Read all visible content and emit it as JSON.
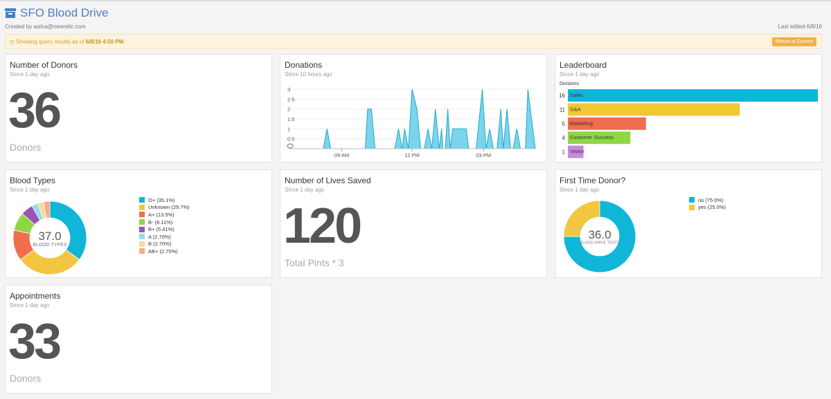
{
  "header": {
    "title": "SFO Blood Drive",
    "created_by": "Created by asilva@newrelic.com",
    "last_edited": "Last edited 6/8/16"
  },
  "banner": {
    "prefix": "Showing query results as of ",
    "timestamp": "6/8/16 4:50 PM",
    "suffix": ".",
    "button": "Return to Current"
  },
  "donors": {
    "title": "Number of Donors",
    "since": "Since 1 day ago",
    "value": "36",
    "unit": "Donors"
  },
  "donations": {
    "title": "Donations",
    "since": "Since 10 hours ago",
    "chart_data": {
      "type": "area",
      "ylim": [
        0,
        3
      ],
      "yticks": [
        "3",
        "2.5",
        "2",
        "1.5",
        "1",
        "0.5",
        "0"
      ],
      "xticks": [
        "09 AM",
        "12 PM",
        "03 PM"
      ],
      "x_fraction": [
        0,
        0.14,
        0.155,
        0.17,
        0.31,
        0.32,
        0.335,
        0.35,
        0.43,
        0.445,
        0.46,
        0.47,
        0.485,
        0.5,
        0.52,
        0.535,
        0.55,
        0.565,
        0.58,
        0.595,
        0.61,
        0.62,
        0.625,
        0.635,
        0.645,
        0.655,
        0.665,
        0.72,
        0.73,
        0.76,
        0.785,
        0.8,
        0.815,
        0.83,
        0.845,
        0.86,
        0.87,
        0.885,
        0.9,
        0.91,
        0.925,
        0.94,
        0.96,
        0.97,
        1
      ],
      "values": [
        0,
        0,
        1,
        0,
        0,
        2,
        2,
        0,
        0,
        1,
        0,
        1,
        0,
        3,
        2,
        0,
        0,
        1,
        0,
        2,
        0,
        1,
        0,
        0,
        2,
        0,
        1,
        1,
        0,
        0,
        3,
        0,
        1,
        0,
        0,
        2,
        0,
        2,
        0,
        0,
        1,
        0,
        0,
        3,
        0
      ],
      "color": "#7ad4eb"
    }
  },
  "leaderboard": {
    "title": "Leaderboard",
    "since": "Since 1 day ago",
    "axis_label": "Divisions",
    "chart_data": {
      "type": "bar",
      "orientation": "horizontal",
      "categories": [
        "Sales",
        "G&A",
        "Marketing",
        "Customer Success",
        "Visitor"
      ],
      "values": [
        16,
        11,
        5,
        4,
        1
      ],
      "colors": [
        "#0fb6d8",
        "#f2c832",
        "#f06d4e",
        "#8fd647",
        "#c68ae0"
      ]
    }
  },
  "blood_types": {
    "title": "Blood Types",
    "since": "Since 1 day ago",
    "center_value": "37.0",
    "center_label": "BLOOD TYPES",
    "chart_data": {
      "type": "pie",
      "categories": [
        "O+",
        "Unknown",
        "A+",
        "B-",
        "B+",
        "A",
        "B",
        "AB+"
      ],
      "values": [
        35.1,
        29.7,
        13.5,
        8.11,
        5.41,
        2.7,
        2.7,
        2.7
      ],
      "legend": [
        "O+ (35.1%)",
        "Unknown (29.7%)",
        "A+ (13.5%)",
        "B- (8.11%)",
        "B+ (5.41%)",
        "A (2.70%)",
        "B (2.70%)",
        "AB+ (2.70%)"
      ],
      "colors": [
        "#0fb6d8",
        "#f2c641",
        "#f06d4e",
        "#8fd647",
        "#9a55b0",
        "#92dbf0",
        "#f8dc92",
        "#f6a98c"
      ]
    }
  },
  "lives": {
    "title": "Number of Lives Saved",
    "since": "Since 1 day ago",
    "value": "120",
    "unit": "Total Pints * 3"
  },
  "first_time": {
    "title": "First Time Donor?",
    "since": "Since 1 day ago",
    "center_value": "36.0",
    "center_label": "BLOOD DRIVE TESTS",
    "chart_data": {
      "type": "pie",
      "categories": [
        "no",
        "yes"
      ],
      "values": [
        75.0,
        25.0
      ],
      "legend": [
        "no (75.0%)",
        "yes (25.0%)"
      ],
      "colors": [
        "#0fb6d8",
        "#f2c641"
      ]
    }
  },
  "appointments": {
    "title": "Appointments",
    "since": "Since 1 day ago",
    "value": "33",
    "unit": "Donors"
  }
}
